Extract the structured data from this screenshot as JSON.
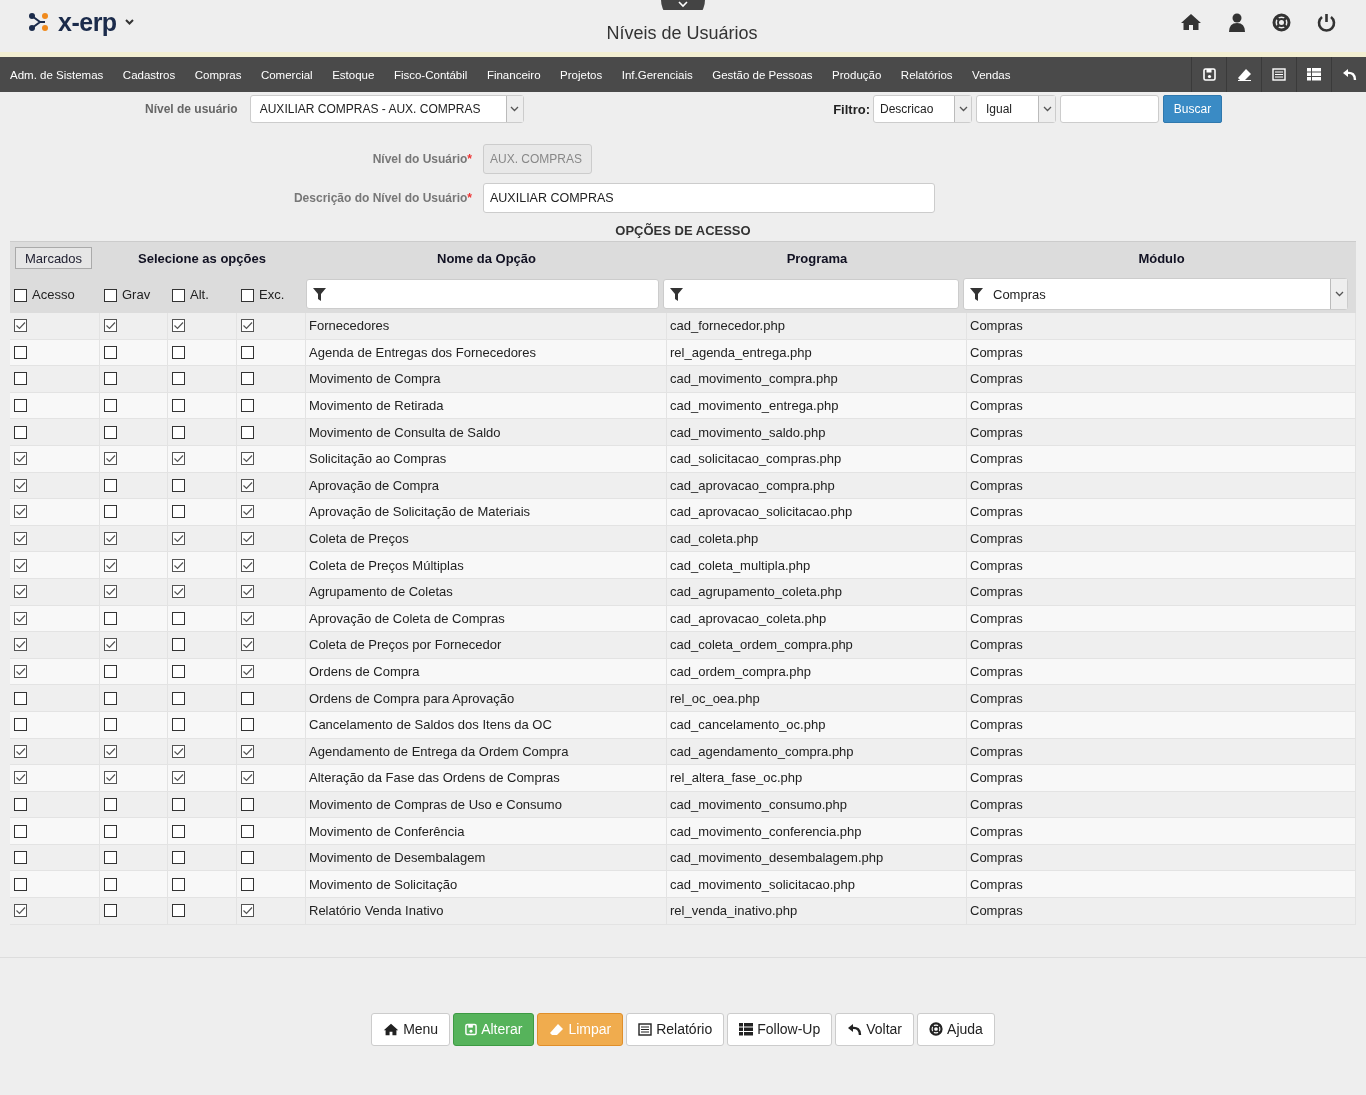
{
  "app": {
    "logo": "x-erp",
    "title": "Níveis de Usuários"
  },
  "menu": [
    "Adm. de Sistemas",
    "Cadastros",
    "Compras",
    "Comercial",
    "Estoque",
    "Fisco-Contábil",
    "Financeiro",
    "Projetos",
    "Inf.Gerenciais",
    "Gestão de Pessoas",
    "Produção",
    "Relatórios",
    "Vendas"
  ],
  "toolbar": {
    "level_label": "Nível de usuário",
    "level_value": "AUXILIAR COMPRAS - AUX. COMPRAS",
    "filter_label": "Filtro:",
    "filter_field": "Descricao",
    "filter_op": "Igual",
    "search_button": "Buscar"
  },
  "form": {
    "code_label": "Nível do Usuário",
    "code_value": "AUX. COMPRAS",
    "desc_label": "Descrição do Nível do Usuário",
    "desc_value": "AUXILIAR COMPRAS",
    "required_mark": "*"
  },
  "table": {
    "title": "OPÇÕES DE ACESSO",
    "marked_button": "Marcados",
    "select_heading": "Selecione as opções",
    "columns": [
      "Nome da Opção",
      "Programa",
      "Módulo"
    ],
    "select_all": [
      {
        "label": "Acesso",
        "checked": false
      },
      {
        "label": "Grav",
        "checked": false
      },
      {
        "label": "Alt.",
        "checked": false
      },
      {
        "label": "Exc.",
        "checked": false
      }
    ],
    "module_filter": "Compras",
    "rows": [
      {
        "acesso": true,
        "grav": true,
        "alt": true,
        "exc": true,
        "name": "Fornecedores",
        "program": "cad_fornecedor.php",
        "module": "Compras"
      },
      {
        "acesso": false,
        "grav": false,
        "alt": false,
        "exc": false,
        "name": "Agenda de Entregas dos Fornecedores",
        "program": "rel_agenda_entrega.php",
        "module": "Compras"
      },
      {
        "acesso": false,
        "grav": false,
        "alt": false,
        "exc": false,
        "name": "Movimento de Compra",
        "program": "cad_movimento_compra.php",
        "module": "Compras"
      },
      {
        "acesso": false,
        "grav": false,
        "alt": false,
        "exc": false,
        "name": "Movimento de Retirada",
        "program": "cad_movimento_entrega.php",
        "module": "Compras"
      },
      {
        "acesso": false,
        "grav": false,
        "alt": false,
        "exc": false,
        "name": "Movimento de Consulta de Saldo",
        "program": "cad_movimento_saldo.php",
        "module": "Compras"
      },
      {
        "acesso": true,
        "grav": true,
        "alt": true,
        "exc": true,
        "name": "Solicitação ao Compras",
        "program": "cad_solicitacao_compras.php",
        "module": "Compras"
      },
      {
        "acesso": true,
        "grav": false,
        "alt": false,
        "exc": true,
        "name": "Aprovação de Compra",
        "program": "cad_aprovacao_compra.php",
        "module": "Compras"
      },
      {
        "acesso": true,
        "grav": false,
        "alt": false,
        "exc": true,
        "name": "Aprovação de Solicitação de Materiais",
        "program": "cad_aprovacao_solicitacao.php",
        "module": "Compras"
      },
      {
        "acesso": true,
        "grav": true,
        "alt": true,
        "exc": true,
        "name": "Coleta de Preços",
        "program": "cad_coleta.php",
        "module": "Compras"
      },
      {
        "acesso": true,
        "grav": true,
        "alt": true,
        "exc": true,
        "name": "Coleta de Preços Múltiplas",
        "program": "cad_coleta_multipla.php",
        "module": "Compras"
      },
      {
        "acesso": true,
        "grav": true,
        "alt": true,
        "exc": true,
        "name": "Agrupamento de Coletas",
        "program": "cad_agrupamento_coleta.php",
        "module": "Compras"
      },
      {
        "acesso": true,
        "grav": false,
        "alt": false,
        "exc": true,
        "name": "Aprovação de Coleta de Compras",
        "program": "cad_aprovacao_coleta.php",
        "module": "Compras"
      },
      {
        "acesso": true,
        "grav": true,
        "alt": false,
        "exc": true,
        "name": "Coleta de Preços por Fornecedor",
        "program": "cad_coleta_ordem_compra.php",
        "module": "Compras"
      },
      {
        "acesso": true,
        "grav": false,
        "alt": false,
        "exc": true,
        "name": "Ordens de Compra",
        "program": "cad_ordem_compra.php",
        "module": "Compras"
      },
      {
        "acesso": false,
        "grav": false,
        "alt": false,
        "exc": false,
        "name": "Ordens de Compra para Aprovação",
        "program": "rel_oc_oea.php",
        "module": "Compras"
      },
      {
        "acesso": false,
        "grav": false,
        "alt": false,
        "exc": false,
        "name": "Cancelamento de Saldos dos Itens da OC",
        "program": "cad_cancelamento_oc.php",
        "module": "Compras"
      },
      {
        "acesso": true,
        "grav": true,
        "alt": true,
        "exc": true,
        "name": "Agendamento de Entrega da Ordem Compra",
        "program": "cad_agendamento_compra.php",
        "module": "Compras"
      },
      {
        "acesso": true,
        "grav": true,
        "alt": true,
        "exc": true,
        "name": "Alteração da Fase das Ordens de Compras",
        "program": "rel_altera_fase_oc.php",
        "module": "Compras"
      },
      {
        "acesso": false,
        "grav": false,
        "alt": false,
        "exc": false,
        "name": "Movimento de Compras de Uso e Consumo",
        "program": "cad_movimento_consumo.php",
        "module": "Compras"
      },
      {
        "acesso": false,
        "grav": false,
        "alt": false,
        "exc": false,
        "name": "Movimento de Conferência",
        "program": "cad_movimento_conferencia.php",
        "module": "Compras"
      },
      {
        "acesso": false,
        "grav": false,
        "alt": false,
        "exc": false,
        "name": "Movimento de Desembalagem",
        "program": "cad_movimento_desembalagem.php",
        "module": "Compras"
      },
      {
        "acesso": false,
        "grav": false,
        "alt": false,
        "exc": false,
        "name": "Movimento de Solicitação",
        "program": "cad_movimento_solicitacao.php",
        "module": "Compras"
      },
      {
        "acesso": true,
        "grav": false,
        "alt": false,
        "exc": true,
        "name": "Relatório Venda Inativo",
        "program": "rel_venda_inativo.php",
        "module": "Compras"
      }
    ]
  },
  "actions": [
    {
      "kind": "menu",
      "label": "Menu"
    },
    {
      "kind": "save",
      "label": "Alterar"
    },
    {
      "kind": "clear",
      "label": "Limpar"
    },
    {
      "kind": "report",
      "label": "Relatório"
    },
    {
      "kind": "followup",
      "label": "Follow-Up"
    },
    {
      "kind": "back",
      "label": "Voltar"
    },
    {
      "kind": "help",
      "label": "Ajuda"
    }
  ]
}
